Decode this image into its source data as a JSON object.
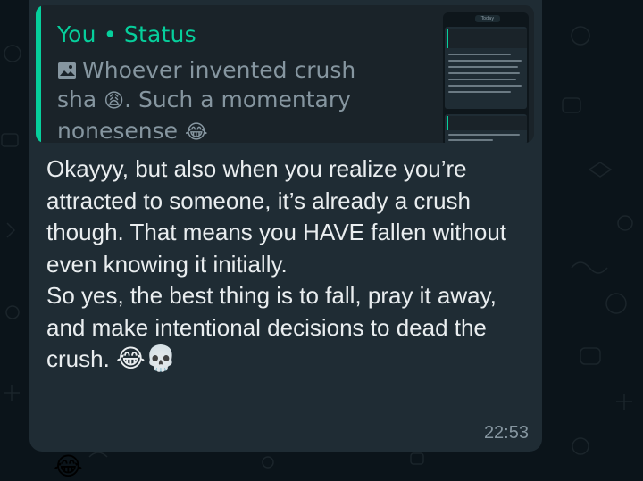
{
  "quoted_status": {
    "author": "You • Status",
    "text_before_emoji": "Whoever invented crush sha ",
    "emoji_weary": "😩",
    "text_after_emoji": ". Such a momentary nonesense ",
    "emoji_laugh": "😂",
    "thumbnail": {
      "day_label": "Today"
    }
  },
  "message": {
    "paragraph_1": "Okayyy, but also when you realize you’re attracted to someone, it’s already a crush though. That means you HAVE fallen without even knowing it initially.",
    "paragraph_2": "So yes, the best thing is to fall, pray it away, and make intentional decisions to dead the crush. ",
    "emoji_laugh": "😂",
    "emoji_skull": "💀",
    "time": "22:53"
  },
  "next_message": {
    "emoji": "😂"
  },
  "colors": {
    "background": "#0b141a",
    "bubble": "#1f2c34",
    "quote_background": "#1a2329",
    "accent": "#06cf9c",
    "text_primary": "#e9edef",
    "text_secondary": "#8696a0"
  }
}
